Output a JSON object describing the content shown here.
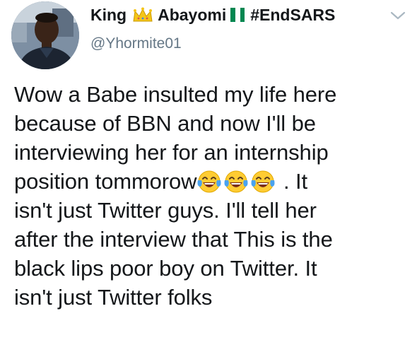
{
  "tweet": {
    "display_name_part1": "King",
    "display_name_part2": "Abayomi",
    "display_name_part3": "#EndSARS",
    "handle": "@Yhormite01",
    "icons": {
      "crown": "crown-icon",
      "flag": "nigeria-flag-icon",
      "emoji": "face-with-tears-of-joy-icon",
      "menu": "chevron-down-icon"
    },
    "body_lines": [
      "Wow a Babe insulted my life here",
      "because of BBN and now I'll be",
      "interviewing her for an internship",
      "position tommorow",
      " . It",
      "isn't just Twitter guys. I'll tell her",
      "after the interview that This is the",
      "black lips poor boy on Twitter. It",
      "isn't just Twitter folks"
    ]
  },
  "colors": {
    "text": "#14171a",
    "muted": "#657786",
    "flag_green": "#008751",
    "flag_white": "#ffffff",
    "chevron": "#aab8c2"
  }
}
